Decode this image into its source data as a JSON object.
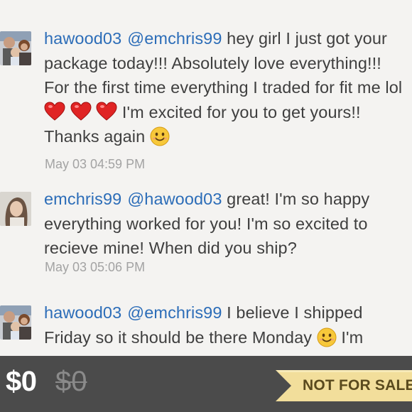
{
  "comments": [
    {
      "username": "hawood03",
      "mention": "@emchris99",
      "text_part1": "hey girl I just got your package today!!! Absolutely love everything!!! For the first time everything I traded for fit me lol",
      "emoji_1": "heart-emoji x3",
      "text_part2": "I'm excited for you to get yours!! Thanks again",
      "emoji_2": "smile-emoji",
      "timestamp": "May 03 04:59 PM"
    },
    {
      "username": "emchris99",
      "mention": "@hawood03",
      "text": "great! I'm so happy everything worked for you! I'm so excited to recieve mine! When did you ship?",
      "timestamp": "May 03 05:06 PM"
    },
    {
      "username": "hawood03",
      "mention": "@emchris99",
      "text_part1": "I believe I shipped Friday so it should be there Monday",
      "emoji": "smile-emoji",
      "text_part2": "I'm"
    }
  ],
  "footer": {
    "price": "$0",
    "original_price": "$0",
    "status_label": "NOT FOR SALE"
  },
  "colors": {
    "username": "#2c6db8",
    "body": "#3f3f3f",
    "timestamp": "#a3a3a3",
    "footer_bg": "#4b4b4b",
    "tag_gold": "#f2de9b"
  }
}
